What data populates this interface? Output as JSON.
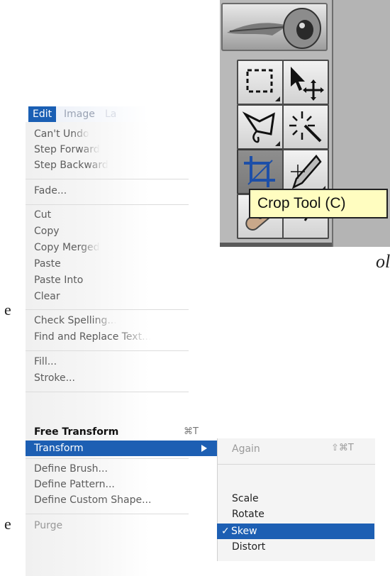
{
  "toolbox": {
    "tooltip": "Crop Tool (C)",
    "tools": [
      {
        "name": "marquee-tool-icon",
        "active": false
      },
      {
        "name": "move-tool-icon",
        "active": false
      },
      {
        "name": "lasso-tool-icon",
        "active": false
      },
      {
        "name": "magic-wand-tool-icon",
        "active": false
      },
      {
        "name": "crop-tool-icon",
        "active": true
      },
      {
        "name": "slice-tool-icon",
        "active": false
      },
      {
        "name": "healing-brush-tool-icon",
        "active": false
      },
      {
        "name": "brush-tool-icon",
        "active": false
      }
    ]
  },
  "menubar": {
    "edit": "Edit",
    "image": "Image",
    "more": "La"
  },
  "edit_menu": {
    "items": [
      {
        "label": "Can't Undo",
        "enabled": false
      },
      {
        "label": "Step Forward",
        "enabled": false
      },
      {
        "label": "Step Backward",
        "enabled": false
      },
      {
        "label": "Fade...",
        "enabled": false
      },
      {
        "label": "Cut",
        "enabled": false
      },
      {
        "label": "Copy",
        "enabled": false
      },
      {
        "label": "Copy Merged",
        "enabled": false
      },
      {
        "label": "Paste",
        "enabled": false
      },
      {
        "label": "Paste Into",
        "enabled": false
      },
      {
        "label": "Clear",
        "enabled": false
      },
      {
        "label": "Check Spelling...",
        "enabled": false
      },
      {
        "label": "Find and Replace Text...",
        "enabled": false
      },
      {
        "label": "Fill...",
        "enabled": false
      },
      {
        "label": "Stroke...",
        "enabled": false
      },
      {
        "label": "Free Transform",
        "enabled": true,
        "shortcut": "⌘T"
      },
      {
        "label": "Transform",
        "enabled": true,
        "selected": true
      },
      {
        "label": "Define Brush...",
        "enabled": false
      },
      {
        "label": "Define Pattern...",
        "enabled": false
      },
      {
        "label": "Define Custom Shape...",
        "enabled": false
      },
      {
        "label": "Purge",
        "enabled": false
      }
    ]
  },
  "transform_submenu": {
    "items": [
      {
        "label": "Again",
        "enabled": false,
        "shortcut": "⇧⌘T"
      },
      {
        "label": "Scale",
        "enabled": true
      },
      {
        "label": "Rotate",
        "enabled": true
      },
      {
        "label": "Skew",
        "enabled": true,
        "checked": true,
        "selected": true
      },
      {
        "label": "Distort",
        "enabled": true
      }
    ],
    "check_mark": "✓"
  },
  "background_fragments": {
    "ol": "ol",
    "e1": "e",
    "e2": "e"
  },
  "colors": {
    "selection": "#1d5fb3",
    "tooltip_bg": "#fffdc0"
  }
}
